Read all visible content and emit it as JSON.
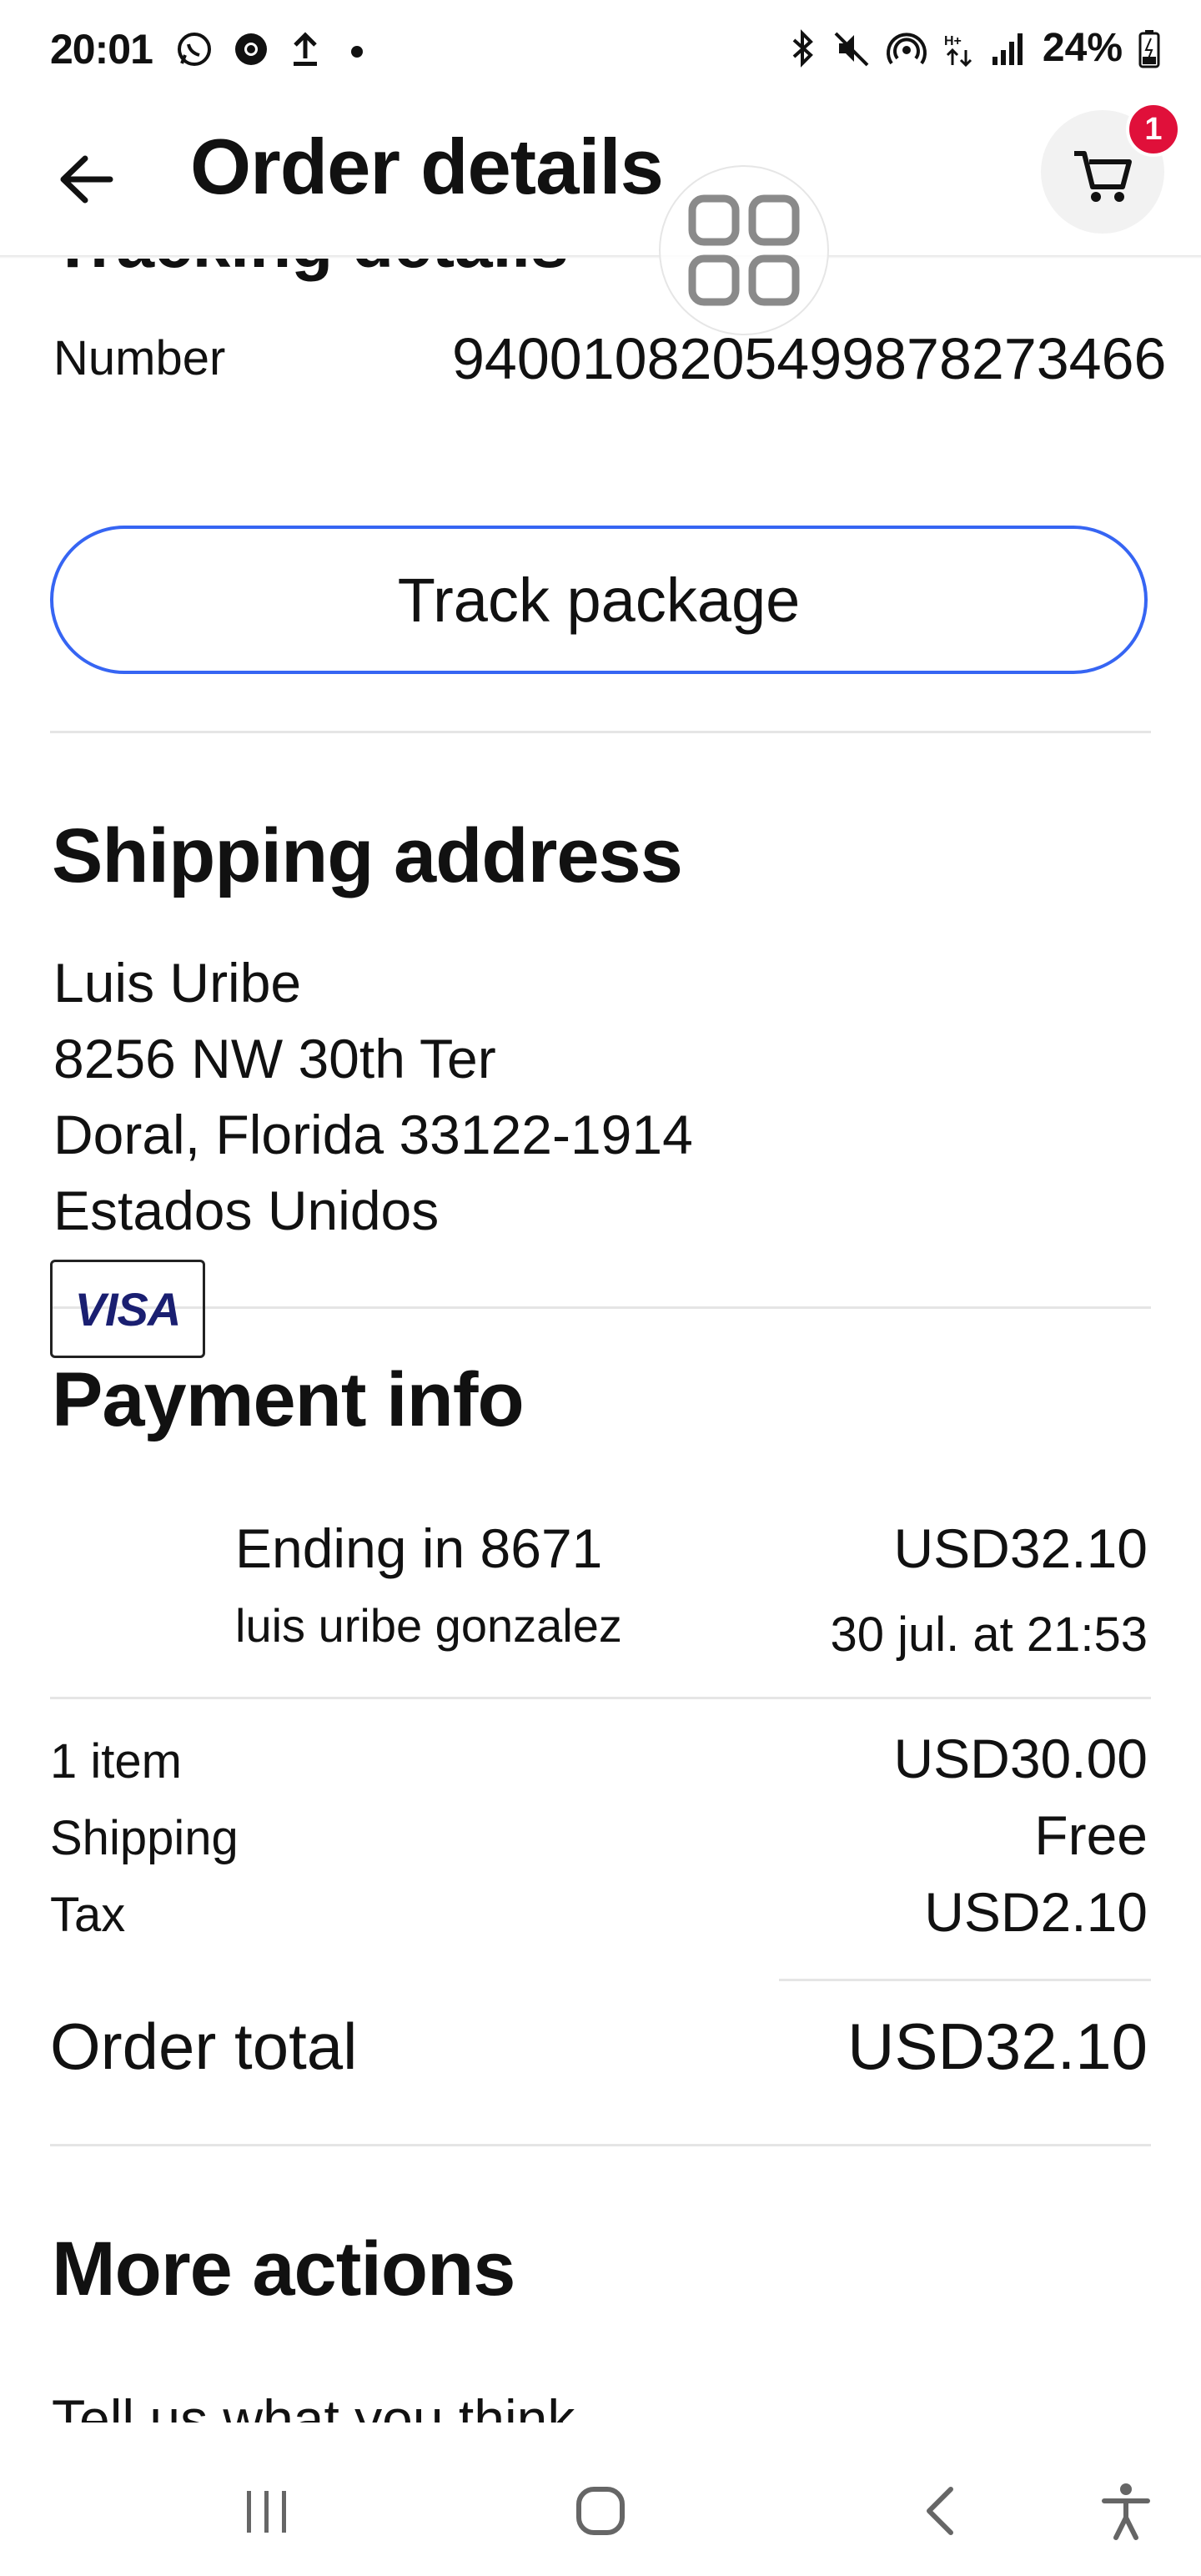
{
  "status_bar": {
    "time": "20:01",
    "battery": "24%",
    "left_icons": [
      "whatsapp-icon",
      "chrome-icon",
      "upload-icon",
      "dot-icon"
    ],
    "right_icons": [
      "bluetooth-icon",
      "mute-icon",
      "hotspot-icon",
      "data-arrows-icon",
      "signal-icon",
      "battery-icon"
    ]
  },
  "header": {
    "title": "Order details",
    "cart_badge": "1"
  },
  "tracking": {
    "partial_heading": "Tracking details",
    "number_label": "Number",
    "number_value": "9400108205499878273466",
    "track_button": "Track package"
  },
  "shipping": {
    "title": "Shipping address",
    "lines": [
      "Luis Uribe",
      "8256 NW 30th Ter",
      "Doral, Florida 33122-1914",
      "Estados Unidos"
    ]
  },
  "payment": {
    "title": "Payment info",
    "card_brand": "VISA",
    "card_ending": "Ending in 8671",
    "card_holder": "luis uribe gonzalez",
    "amount": "USD32.10",
    "date": "30 jul. at 21:53"
  },
  "summary": {
    "rows": [
      {
        "label": "1 item",
        "value": "USD30.00"
      },
      {
        "label": "Shipping",
        "value": "Free"
      },
      {
        "label": "Tax",
        "value": "USD2.10"
      }
    ],
    "total_label": "Order total",
    "total_value": "USD32.10"
  },
  "more_actions": {
    "title": "More actions",
    "first_item": "Tell us what you think"
  },
  "colors": {
    "accent_blue": "#3665f3",
    "badge_red": "#e0103a",
    "visa_blue": "#1a1f71"
  }
}
